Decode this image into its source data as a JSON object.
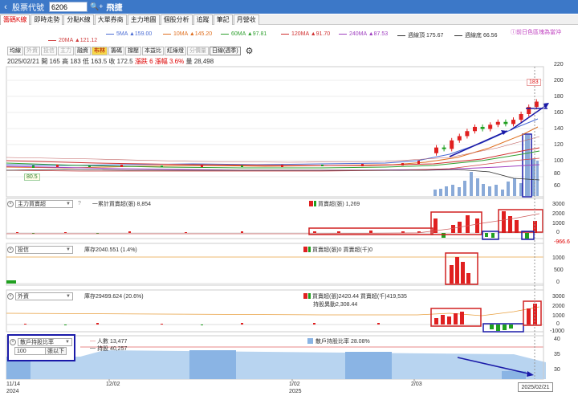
{
  "topbar": {
    "back_label": "‹",
    "title": "股票代號",
    "code": "6206",
    "search_icon": "search-plus-icon",
    "stock_name": "飛捷"
  },
  "tabs": [
    "籌碼K線",
    "即時走勢",
    "分點K線",
    "大單券商",
    "主力地圖",
    "個股分析",
    "追蹤",
    "筆記",
    "月營收"
  ],
  "ma_legend": [
    {
      "label": "5MA ▲159.00",
      "color": "#4a6cd4"
    },
    {
      "label": "10MA ▲145.20",
      "color": "#e07020"
    },
    {
      "label": "60MA ▲97.81",
      "color": "#30a030"
    },
    {
      "label": "120MA ▲91.70",
      "color": "#d03030"
    },
    {
      "label": "240MA ▲87.53",
      "color": "#a040c0"
    },
    {
      "label": "週線頂 175.67",
      "color": "#303030"
    },
    {
      "label": "週線底 66.56",
      "color": "#303030"
    },
    {
      "label": "20MA ▲121.12",
      "color": "#d04040"
    }
  ],
  "intraday_note": "ⓘ前日色區塊為當沖",
  "subtabs": [
    "均線",
    "外資",
    "投信",
    "主力",
    "融資",
    "布林",
    "籌碼",
    "撐壓",
    "本益比",
    "紅綠燈",
    "分價量",
    "日線(週季)"
  ],
  "ohlc": {
    "date": "2025/02/21",
    "open": "開 165",
    "high": "高 183",
    "low": "低 163.5",
    "close": "收 172.5",
    "change": "漲跌 6",
    "pct": "漲幅 3.6%",
    "volume": "量 28,498"
  },
  "price_axis": [
    "220",
    "200",
    "180",
    "160",
    "140",
    "120",
    "100",
    "80",
    "60"
  ],
  "annotations": {
    "high": "183",
    "low": "80.5"
  },
  "panels": [
    {
      "select": "主力買賣超",
      "q": "?",
      "left_text": "一累計買賣超(張) 8,854",
      "right_text": "買賣超(張) 1,269",
      "axis": [
        "3000",
        "2000",
        "1000",
        "0"
      ]
    },
    {
      "select": "投信",
      "left_text": "庫存2040.551 (1.4%)",
      "right_text": "買賣超(張)0 買賣超(千)0",
      "axis": [
        "1000",
        "500",
        "0"
      ],
      "top_value": "-966.6"
    },
    {
      "select": "外資",
      "left_text": "庫存29499.624 (20.6%)",
      "right_text": "買賣超(張)2420.44 買賣超(千)419,535",
      "right_text2": "持股異動2,308.44",
      "axis": [
        "3000",
        "2000",
        "1000",
        "0",
        "-1000"
      ]
    },
    {
      "select": "散戶持股比率",
      "left_text": "人數 13,477",
      "left_text2": "持股 40,257",
      "right_text": "散戶持股比率 28.08%",
      "axis": [
        "40",
        "35",
        "30"
      ],
      "threshold": "100",
      "threshold_btn": "張以下"
    }
  ],
  "xaxis": [
    {
      "label": "11/14",
      "sub": "2024"
    },
    {
      "label": "12/02",
      "sub": ""
    },
    {
      "label": "1/02",
      "sub": "2025"
    },
    {
      "label": "2/03",
      "sub": ""
    }
  ],
  "cursor_date": "2025/02/21",
  "chart_data": {
    "type": "candlestick",
    "y_axis_range": [
      50,
      225
    ],
    "recent_candles": [
      {
        "o": 100,
        "c": 108
      },
      {
        "o": 108,
        "c": 106
      },
      {
        "o": 106,
        "c": 118
      },
      {
        "o": 118,
        "c": 124
      },
      {
        "o": 124,
        "c": 131
      },
      {
        "o": 131,
        "c": 137
      },
      {
        "o": 137,
        "c": 134
      },
      {
        "o": 134,
        "c": 140
      },
      {
        "o": 140,
        "c": 144
      },
      {
        "o": 144,
        "c": 141
      },
      {
        "o": 141,
        "c": 147
      },
      {
        "o": 147,
        "c": 155
      },
      {
        "o": 155,
        "c": 165
      },
      {
        "o": 165,
        "c": 172.5
      }
    ]
  },
  "colors": {
    "up": "#e02020",
    "down": "#20a020",
    "accent": "#3c78c8",
    "annotation": "#1a1aa8"
  }
}
